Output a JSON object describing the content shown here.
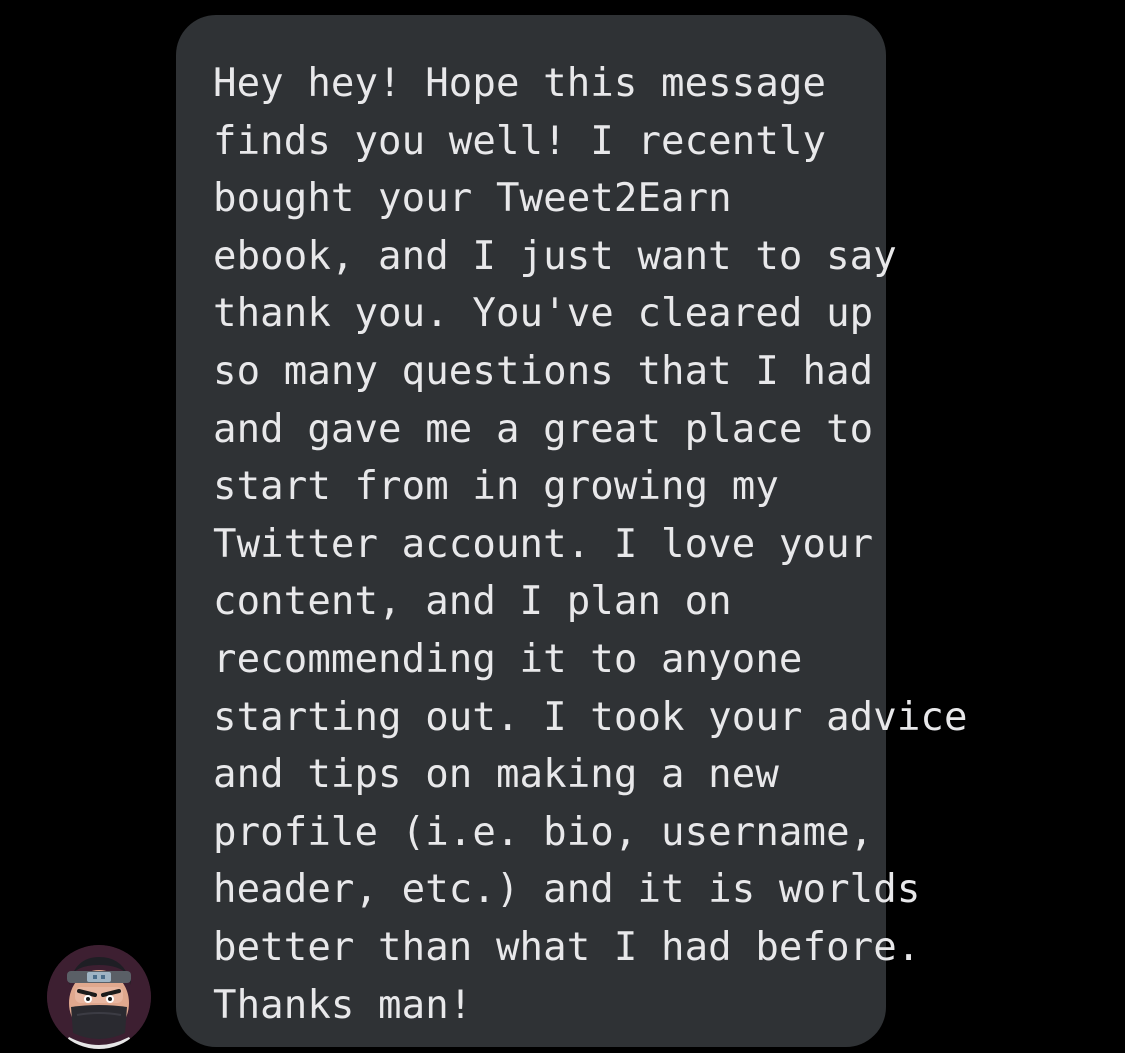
{
  "conversation": {
    "message": {
      "lines": [
        "Hey hey! Hope this message",
        "finds you well! I recently",
        "bought your Tweet2Earn",
        "ebook, and I just want to say",
        "thank you. You've cleared up",
        "so many questions that I had",
        "and gave me a great place to",
        "start from in growing my",
        "Twitter account. I love your",
        "content, and I plan on",
        "recommending it to anyone",
        "starting out. I took your advice",
        "and tips on making a new",
        "profile (i.e. bio, username,",
        "header, etc.) and it is worlds",
        "better than what I had before.",
        "Thanks man!"
      ]
    },
    "sender_avatar_icon": "ninja-avatar-icon"
  },
  "colors": {
    "background": "#000000",
    "bubble": "#2f3235",
    "text": "#e8e8ea"
  }
}
